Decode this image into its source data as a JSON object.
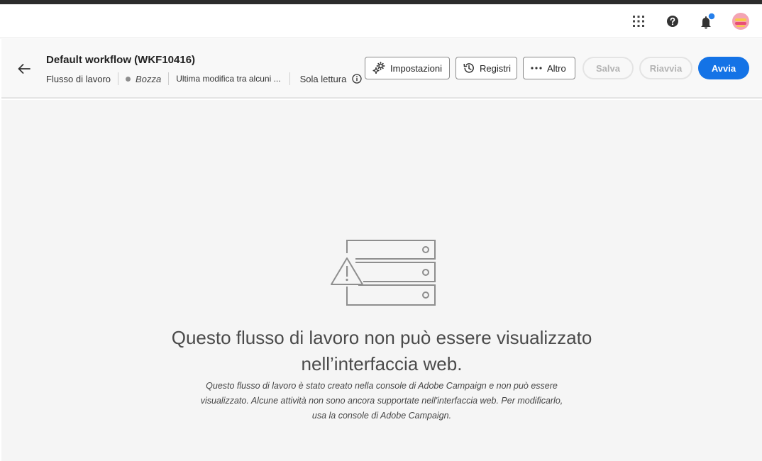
{
  "shell": {
    "icons": [
      "apps-grid-icon",
      "help-icon",
      "bell-icon",
      "avatar"
    ],
    "notification_badge_color": "#2680eb"
  },
  "header": {
    "title": "Default workflow (WKF10416)",
    "meta": {
      "type": "Flusso di lavoro",
      "status": "Bozza",
      "modified": "Ultima modifica tra alcuni ...",
      "readonly": "Sola lettura"
    },
    "actions": {
      "settings": "Impostazioni",
      "logs": "Registri",
      "more": "Altro",
      "save": "Salva",
      "restart": "Riavvia",
      "start": "Avvia"
    },
    "colors": {
      "primary": "#1473e6"
    }
  },
  "empty_state": {
    "illustration": "server-warning-illustration",
    "title_line1": "Questo flusso di lavoro non può essere visualizzato",
    "title_line2": "nell’interfaccia web.",
    "desc_line1": "Questo flusso di lavoro è stato creato nella console di Adobe Campaign e non può essere",
    "desc_line2": "visualizzato. Alcune attività non sono ancora supportate nell'interfaccia web. Per modificarlo,",
    "desc_line3": "usa la console di Adobe Campaign."
  }
}
